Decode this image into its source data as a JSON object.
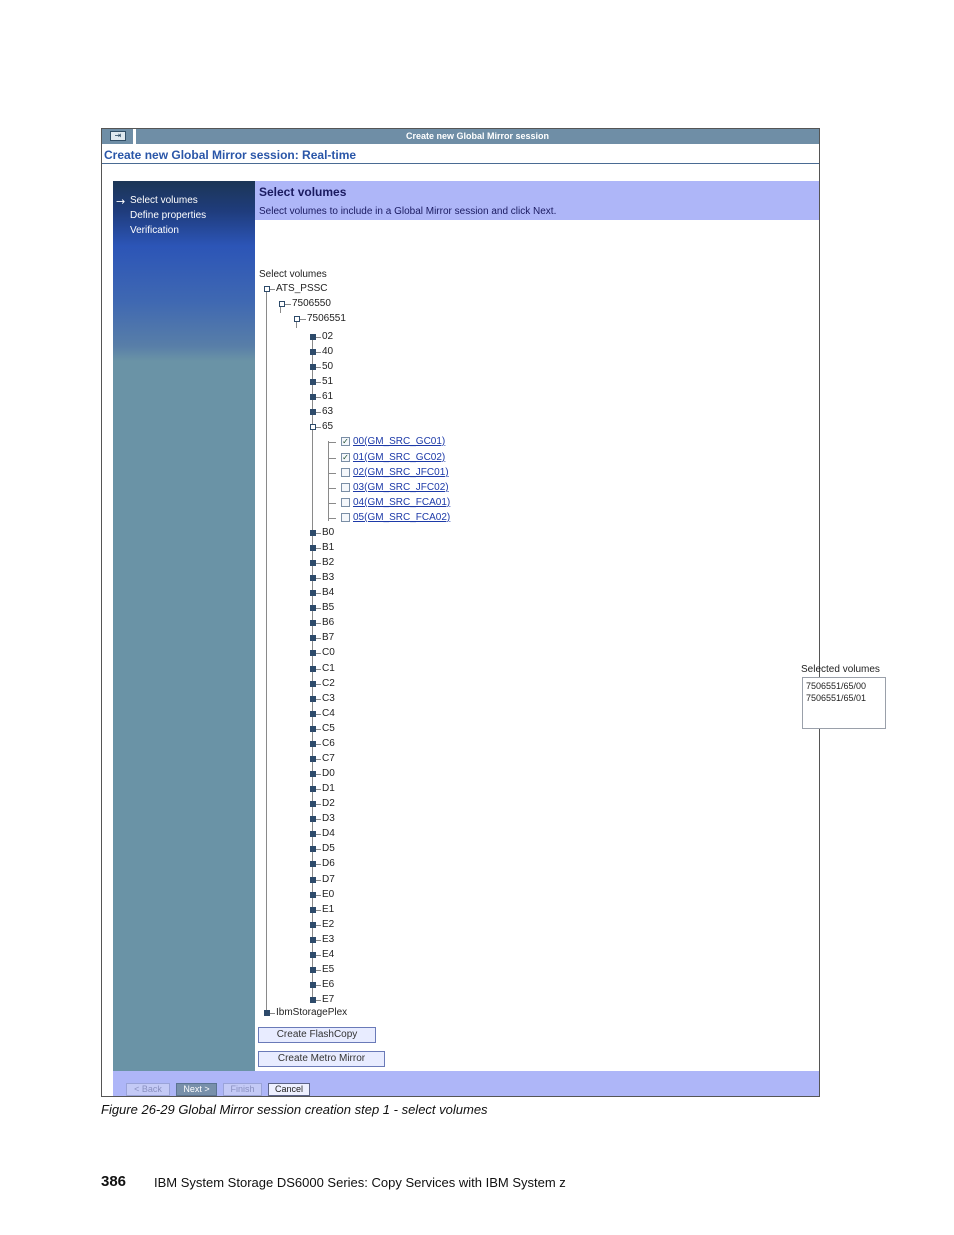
{
  "window": {
    "title": "Create new Global Mirror session",
    "heading": "Create new Global Mirror session: Real-time",
    "title_icon": "exit-icon",
    "title_icon_glyph": "⇥"
  },
  "wizard_steps": {
    "current_marker": "→",
    "items": [
      "Select volumes",
      "Define properties",
      "Verification"
    ]
  },
  "section": {
    "title": "Select volumes",
    "description": "Select volumes to include in a Global Mirror session and click Next."
  },
  "tree": {
    "label": "Select volumes",
    "root": "ATS_PSSC",
    "level1": "7506550",
    "level2": "7506551",
    "lss_before": [
      "02",
      "40",
      "50",
      "51",
      "61",
      "63"
    ],
    "expanded_lss": "65",
    "volumes": [
      {
        "label": "00(GM_SRC_GC01)",
        "checked": true
      },
      {
        "label": "01(GM_SRC_GC02)",
        "checked": true
      },
      {
        "label": "02(GM_SRC_JFC01)",
        "checked": false
      },
      {
        "label": "03(GM_SRC_JFC02)",
        "checked": false
      },
      {
        "label": "04(GM_SRC_FCA01)",
        "checked": false
      },
      {
        "label": "05(GM_SRC_FCA02)",
        "checked": false
      }
    ],
    "lss_after": [
      "B0",
      "B1",
      "B2",
      "B3",
      "B4",
      "B5",
      "B6",
      "B7",
      "C0",
      "C1",
      "C2",
      "C3",
      "C4",
      "C5",
      "C6",
      "C7",
      "D0",
      "D1",
      "D2",
      "D3",
      "D4",
      "D5",
      "D6",
      "D7",
      "E0",
      "E1",
      "E2",
      "E3",
      "E4",
      "E5",
      "E6",
      "E7"
    ],
    "other_root": "IbmStoragePlex",
    "check_glyph": "✓"
  },
  "selected_volumes": {
    "label": "Selected volumes",
    "items": [
      "7506551/65/00",
      "7506551/65/01"
    ]
  },
  "actions": {
    "create_flashcopy": "Create FlashCopy",
    "create_metro_mirror": "Create Metro Mirror"
  },
  "navigation": {
    "back": "< Back",
    "next": "Next >",
    "finish": "Finish",
    "cancel": "Cancel"
  },
  "document": {
    "caption": "Figure 26-29   Global Mirror session creation step 1 - select volumes",
    "page_number": "386",
    "book_title": "IBM System Storage DS6000 Series: Copy Services with IBM System z"
  }
}
